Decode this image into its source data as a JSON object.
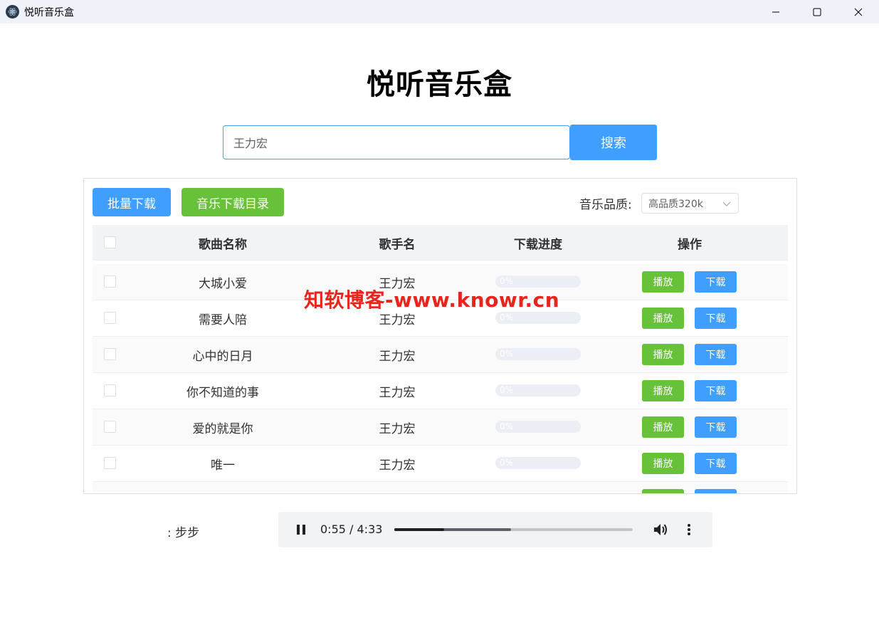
{
  "window": {
    "title": "悦听音乐盒",
    "icons": [
      "app-icon",
      "minimize-icon",
      "maximize-icon",
      "close-icon"
    ]
  },
  "header": {
    "title": "悦听音乐盒"
  },
  "search": {
    "value": "王力宏",
    "button_label": "搜索"
  },
  "toolbar": {
    "batch_download_label": "批量下载",
    "music_dir_label": "音乐下载目录",
    "quality_label": "音乐品质:",
    "quality_selected": "高品质320k"
  },
  "table": {
    "headers": {
      "name": "歌曲名称",
      "artist": "歌手名",
      "progress": "下载进度",
      "actions": "操作"
    },
    "play_label": "播放",
    "download_label": "下载",
    "rows": [
      {
        "name": "大城小爱",
        "artist": "王力宏",
        "progress": 0,
        "progress_text": "0%"
      },
      {
        "name": "需要人陪",
        "artist": "王力宏",
        "progress": 0,
        "progress_text": "0%"
      },
      {
        "name": "心中的日月",
        "artist": "王力宏",
        "progress": 0,
        "progress_text": "0%"
      },
      {
        "name": "你不知道的事",
        "artist": "王力宏",
        "progress": 0,
        "progress_text": "0%"
      },
      {
        "name": "爱的就是你",
        "artist": "王力宏",
        "progress": 0,
        "progress_text": "0%"
      },
      {
        "name": "唯一",
        "artist": "王力宏",
        "progress": 0,
        "progress_text": "0%"
      }
    ]
  },
  "player": {
    "now_playing": ": 步步",
    "time": "0:55 / 4:33",
    "played_fraction": 0.21,
    "buffered_fraction": 0.49
  },
  "watermark": "知软博客-www.knowr.cn",
  "colors": {
    "primary": "#409eff",
    "success": "#67c23a",
    "watermark": "#e8251c"
  }
}
